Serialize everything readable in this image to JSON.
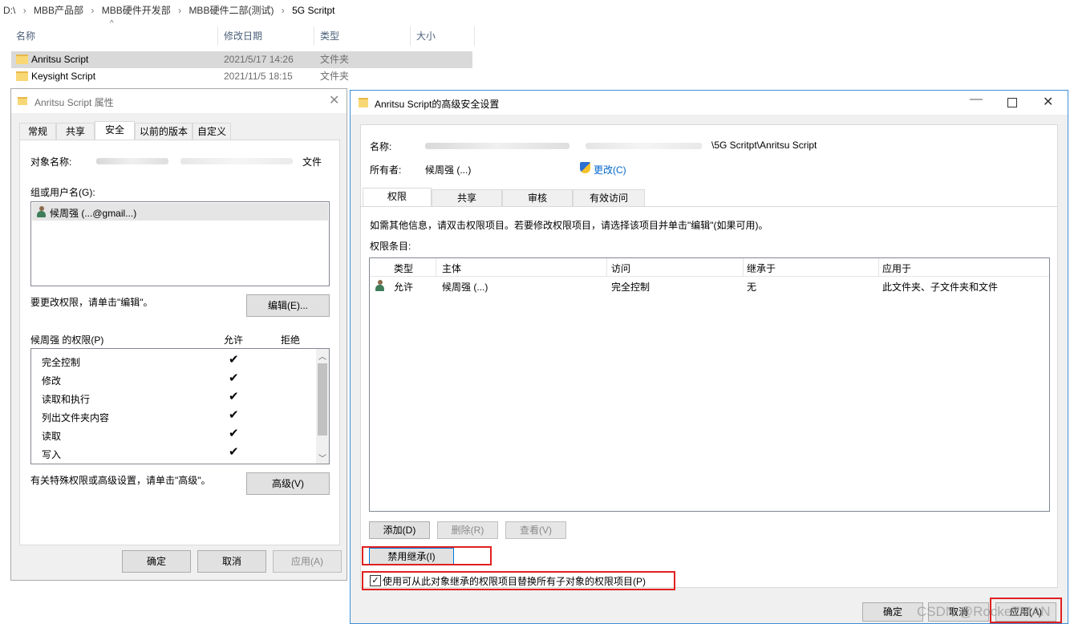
{
  "explorer": {
    "breadcrumb": [
      "D:\\",
      "MBB产品部",
      "MBB硬件开发部",
      "MBB硬件二部(测试)",
      "5G Scritpt"
    ],
    "columns": [
      "名称",
      "修改日期",
      "类型",
      "大小"
    ],
    "rows": [
      {
        "name": "Anritsu Script",
        "date": "2021/5/17 14:26",
        "type": "文件夹"
      },
      {
        "name": "Keysight Script",
        "date": "2021/11/5 18:15",
        "type": "文件夹"
      }
    ]
  },
  "props": {
    "title": "Anritsu Script 属性",
    "tabs": [
      "常规",
      "共享",
      "安全",
      "以前的版本",
      "自定义"
    ],
    "object_label": "对象名称:",
    "object_value": "...\\5G Scritpt\\Anritsu Script",
    "object_suffix": "文件",
    "group_label": "组或用户名(G):",
    "group_user": "候周强 (...@gmail...)",
    "change_hint": "要更改权限，请单击\"编辑\"。",
    "edit_button": "编辑(E)...",
    "perm_header": "候周强 的权限(P)",
    "allow": "允许",
    "deny": "拒绝",
    "perms": [
      "完全控制",
      "修改",
      "读取和执行",
      "列出文件夹内容",
      "读取",
      "写入"
    ],
    "special_hint": "有关特殊权限或高级设置，请单击\"高级\"。",
    "advanced_button": "高级(V)",
    "ok": "确定",
    "cancel": "取消",
    "apply": "应用(A)"
  },
  "adv": {
    "title": "Anritsu Script的高级安全设置",
    "name_label": "名称:",
    "name_value": "\\5G Scritpt\\Anritsu Script",
    "owner_label": "所有者:",
    "owner_value": "候周强 (...)",
    "change_link": "更改(C)",
    "tabs": [
      "权限",
      "共享",
      "审核",
      "有效访问"
    ],
    "info": "如需其他信息，请双击权限项目。若要修改权限项目，请选择该项目并单击\"编辑\"(如果可用)。",
    "entries_label": "权限条目:",
    "table_headers": [
      "类型",
      "主体",
      "访问",
      "继承于",
      "应用于"
    ],
    "table_rows": [
      {
        "type": "允许",
        "principal": "候周强 (...)",
        "access": "完全控制",
        "inherited": "无",
        "applies": "此文件夹、子文件夹和文件"
      }
    ],
    "add": "添加(D)",
    "remove": "删除(R)",
    "view": "查看(V)",
    "disable_inherit": "禁用继承(I)",
    "replace_checkbox": "使用可从此对象继承的权限项目替换所有子对象的权限项目(P)",
    "ok": "确定",
    "cancel": "取消",
    "apply": "应用(A)",
    "watermark": "CSDN @RockeTMAN"
  },
  "colors": {
    "accent": "#0078d7",
    "highlight_box": "#e02020",
    "selected_row": "#d9d9d9"
  }
}
